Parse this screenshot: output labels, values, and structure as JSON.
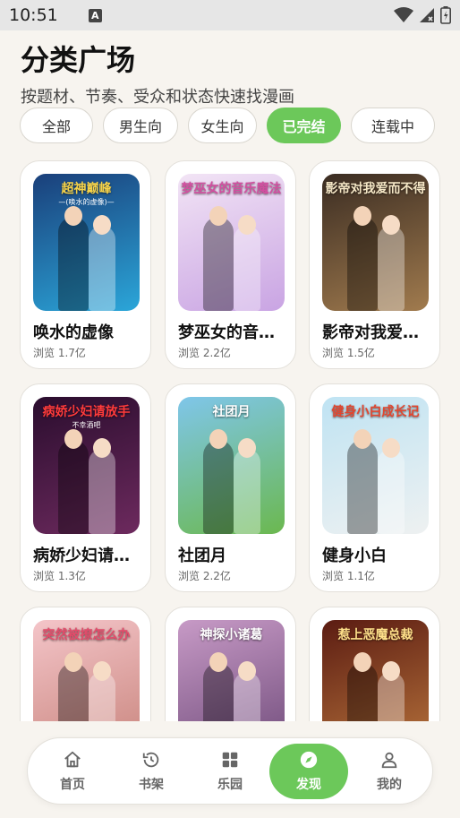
{
  "status": {
    "time": "10:51",
    "notif": "A"
  },
  "header": {
    "title": "分类广场",
    "subtitle": "按题材、节奏、受众和状态快速找漫画"
  },
  "filters": [
    {
      "label": "全部",
      "active": false
    },
    {
      "label": "男生向",
      "active": false
    },
    {
      "label": "女生向",
      "active": false
    },
    {
      "label": "已完结",
      "active": true
    },
    {
      "label": "连载中",
      "active": false
    }
  ],
  "comics": [
    {
      "name": "唤水的虚像",
      "views": "浏览 1.7亿",
      "cover_title": "超神巅峰",
      "cover_sub": "—(唤水的虚像)—",
      "colors": [
        "#1a3f7a",
        "#2ba6d9"
      ],
      "title_color": "#f6d34a"
    },
    {
      "name": "梦巫女的音乐魔法",
      "views": "浏览 2.2亿",
      "cover_title": "梦巫女的音乐魔法",
      "cover_sub": "",
      "colors": [
        "#f2e4f5",
        "#c9a4e3"
      ],
      "title_color": "#d24fa0"
    },
    {
      "name": "影帝对我爱而不得",
      "views": "浏览 1.5亿",
      "cover_title": "影帝对我爱而不得",
      "cover_sub": "",
      "colors": [
        "#3a2c22",
        "#a17b4e"
      ],
      "title_color": "#f5e7c6"
    },
    {
      "name": "病娇少妇请不幸酒吧",
      "views": "浏览 1.3亿",
      "cover_title": "病娇少妇请放手",
      "cover_sub": "不幸酒吧",
      "colors": [
        "#2a0d2e",
        "#6d2a5e"
      ],
      "title_color": "#ff3b3b"
    },
    {
      "name": "社团月",
      "views": "浏览 2.2亿",
      "cover_title": "社团月",
      "cover_sub": "",
      "colors": [
        "#7fc6ea",
        "#6bb84f"
      ],
      "title_color": "#ffffff"
    },
    {
      "name": "健身小白",
      "views": "浏览 1.1亿",
      "cover_title": "健身小白成长记",
      "cover_sub": "",
      "colors": [
        "#bfe3f3",
        "#eef1f1"
      ],
      "title_color": "#e2462f"
    },
    {
      "name": "突然被撩怎么办",
      "views": "",
      "cover_title": "突然被撩怎么办",
      "cover_sub": "",
      "colors": [
        "#f4c5c9",
        "#c8847c"
      ],
      "title_color": "#e34b6a"
    },
    {
      "name": "神探小诸葛",
      "views": "",
      "cover_title": "神探小诸葛",
      "cover_sub": "",
      "colors": [
        "#c79ac6",
        "#6f4b7a"
      ],
      "title_color": "#ffffff"
    },
    {
      "name": "惹上恶魔总裁",
      "views": "",
      "cover_title": "惹上恶魔总裁",
      "cover_sub": "",
      "colors": [
        "#5b1c12",
        "#b8743c"
      ],
      "title_color": "#ffe08a"
    }
  ],
  "nav": [
    {
      "label": "首页",
      "icon": "home-icon",
      "active": false
    },
    {
      "label": "书架",
      "icon": "history-icon",
      "active": false
    },
    {
      "label": "乐园",
      "icon": "grid-icon",
      "active": false
    },
    {
      "label": "发现",
      "icon": "compass-icon",
      "active": true
    },
    {
      "label": "我的",
      "icon": "user-icon",
      "active": false
    }
  ],
  "accent": "#6cc85a"
}
